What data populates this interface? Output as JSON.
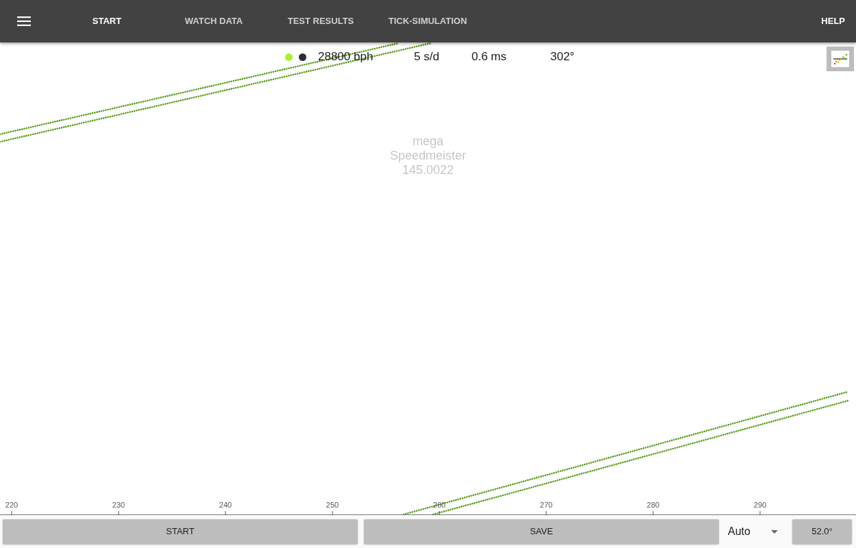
{
  "header": {
    "tabs": [
      {
        "label": "START",
        "selected": true
      },
      {
        "label": "WATCH DATA",
        "selected": false
      },
      {
        "label": "TEST RESULTS",
        "selected": false
      },
      {
        "label": "TICK-SIMULATION",
        "selected": false
      }
    ],
    "help": "HELP"
  },
  "readings": {
    "indicators": [
      {
        "color": "#a8f231"
      },
      {
        "color": "#2e2e2e"
      }
    ],
    "values": [
      "28800 bph",
      "5 s/d",
      "0.6 ms",
      "302°"
    ]
  },
  "watch_info": [
    "mega",
    "Speedmeister",
    "145.0022"
  ],
  "x_axis": {
    "labels": [
      "220",
      "230",
      "240",
      "250",
      "260",
      "270",
      "280",
      "290"
    ]
  },
  "footer": {
    "start_button": "START",
    "save_button": "SAVE",
    "mode_dropdown": {
      "value": "Auto"
    },
    "lift_angle_button": "52.0°"
  }
}
